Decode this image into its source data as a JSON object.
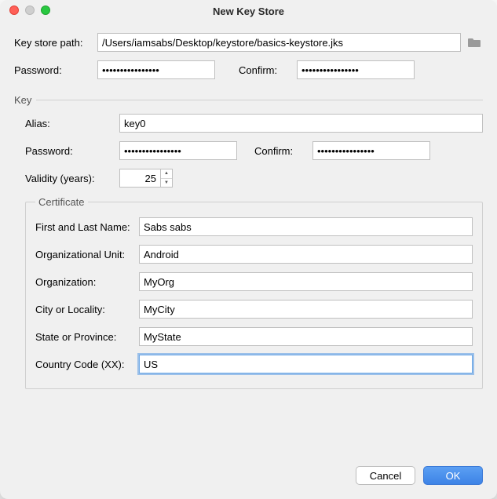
{
  "window": {
    "title": "New Key Store"
  },
  "path": {
    "label": "Key store path:",
    "value": "/Users/iamsabs/Desktop/keystore/basics-keystore.jks"
  },
  "password": {
    "label": "Password:",
    "value": "••••••••••••••••",
    "confirm_label": "Confirm:",
    "confirm_value": "••••••••••••••••"
  },
  "key_section": {
    "label": "Key"
  },
  "key": {
    "alias_label": "Alias:",
    "alias_value": "key0",
    "password_label": "Password:",
    "password_value": "••••••••••••••••",
    "confirm_label": "Confirm:",
    "confirm_value": "••••••••••••••••",
    "validity_label": "Validity (years):",
    "validity_value": "25"
  },
  "cert": {
    "legend": "Certificate",
    "first_last_label": "First and Last Name:",
    "first_last_value": "Sabs sabs",
    "ou_label": "Organizational Unit:",
    "ou_value": "Android",
    "org_label": "Organization:",
    "org_value": "MyOrg",
    "city_label": "City or Locality:",
    "city_value": "MyCity",
    "state_label": "State or Province:",
    "state_value": "MyState",
    "cc_label": "Country Code (XX):",
    "cc_value": "US"
  },
  "buttons": {
    "cancel": "Cancel",
    "ok": "OK"
  }
}
